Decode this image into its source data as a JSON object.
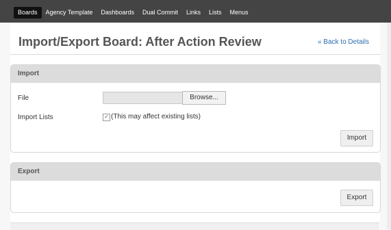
{
  "nav": {
    "items": [
      "Boards",
      "Agency Template",
      "Dashboards",
      "Dual Commit",
      "Links",
      "Lists",
      "Menus"
    ]
  },
  "page": {
    "title": "Import/Export Board: After Action Review",
    "back_link": "« Back to Details"
  },
  "import_panel": {
    "header": "Import",
    "file_label": "File",
    "browse_label": "Browse...",
    "import_lists_label": "Import Lists",
    "import_lists_checked": true,
    "checkbox_text": "(This may affect existing lists)",
    "import_button": "Import"
  },
  "export_panel": {
    "header": "Export",
    "export_button": "Export"
  },
  "colors": {
    "topbar": "#444444",
    "panel_header": "#dcdcdc",
    "link": "#2b6cb0"
  }
}
